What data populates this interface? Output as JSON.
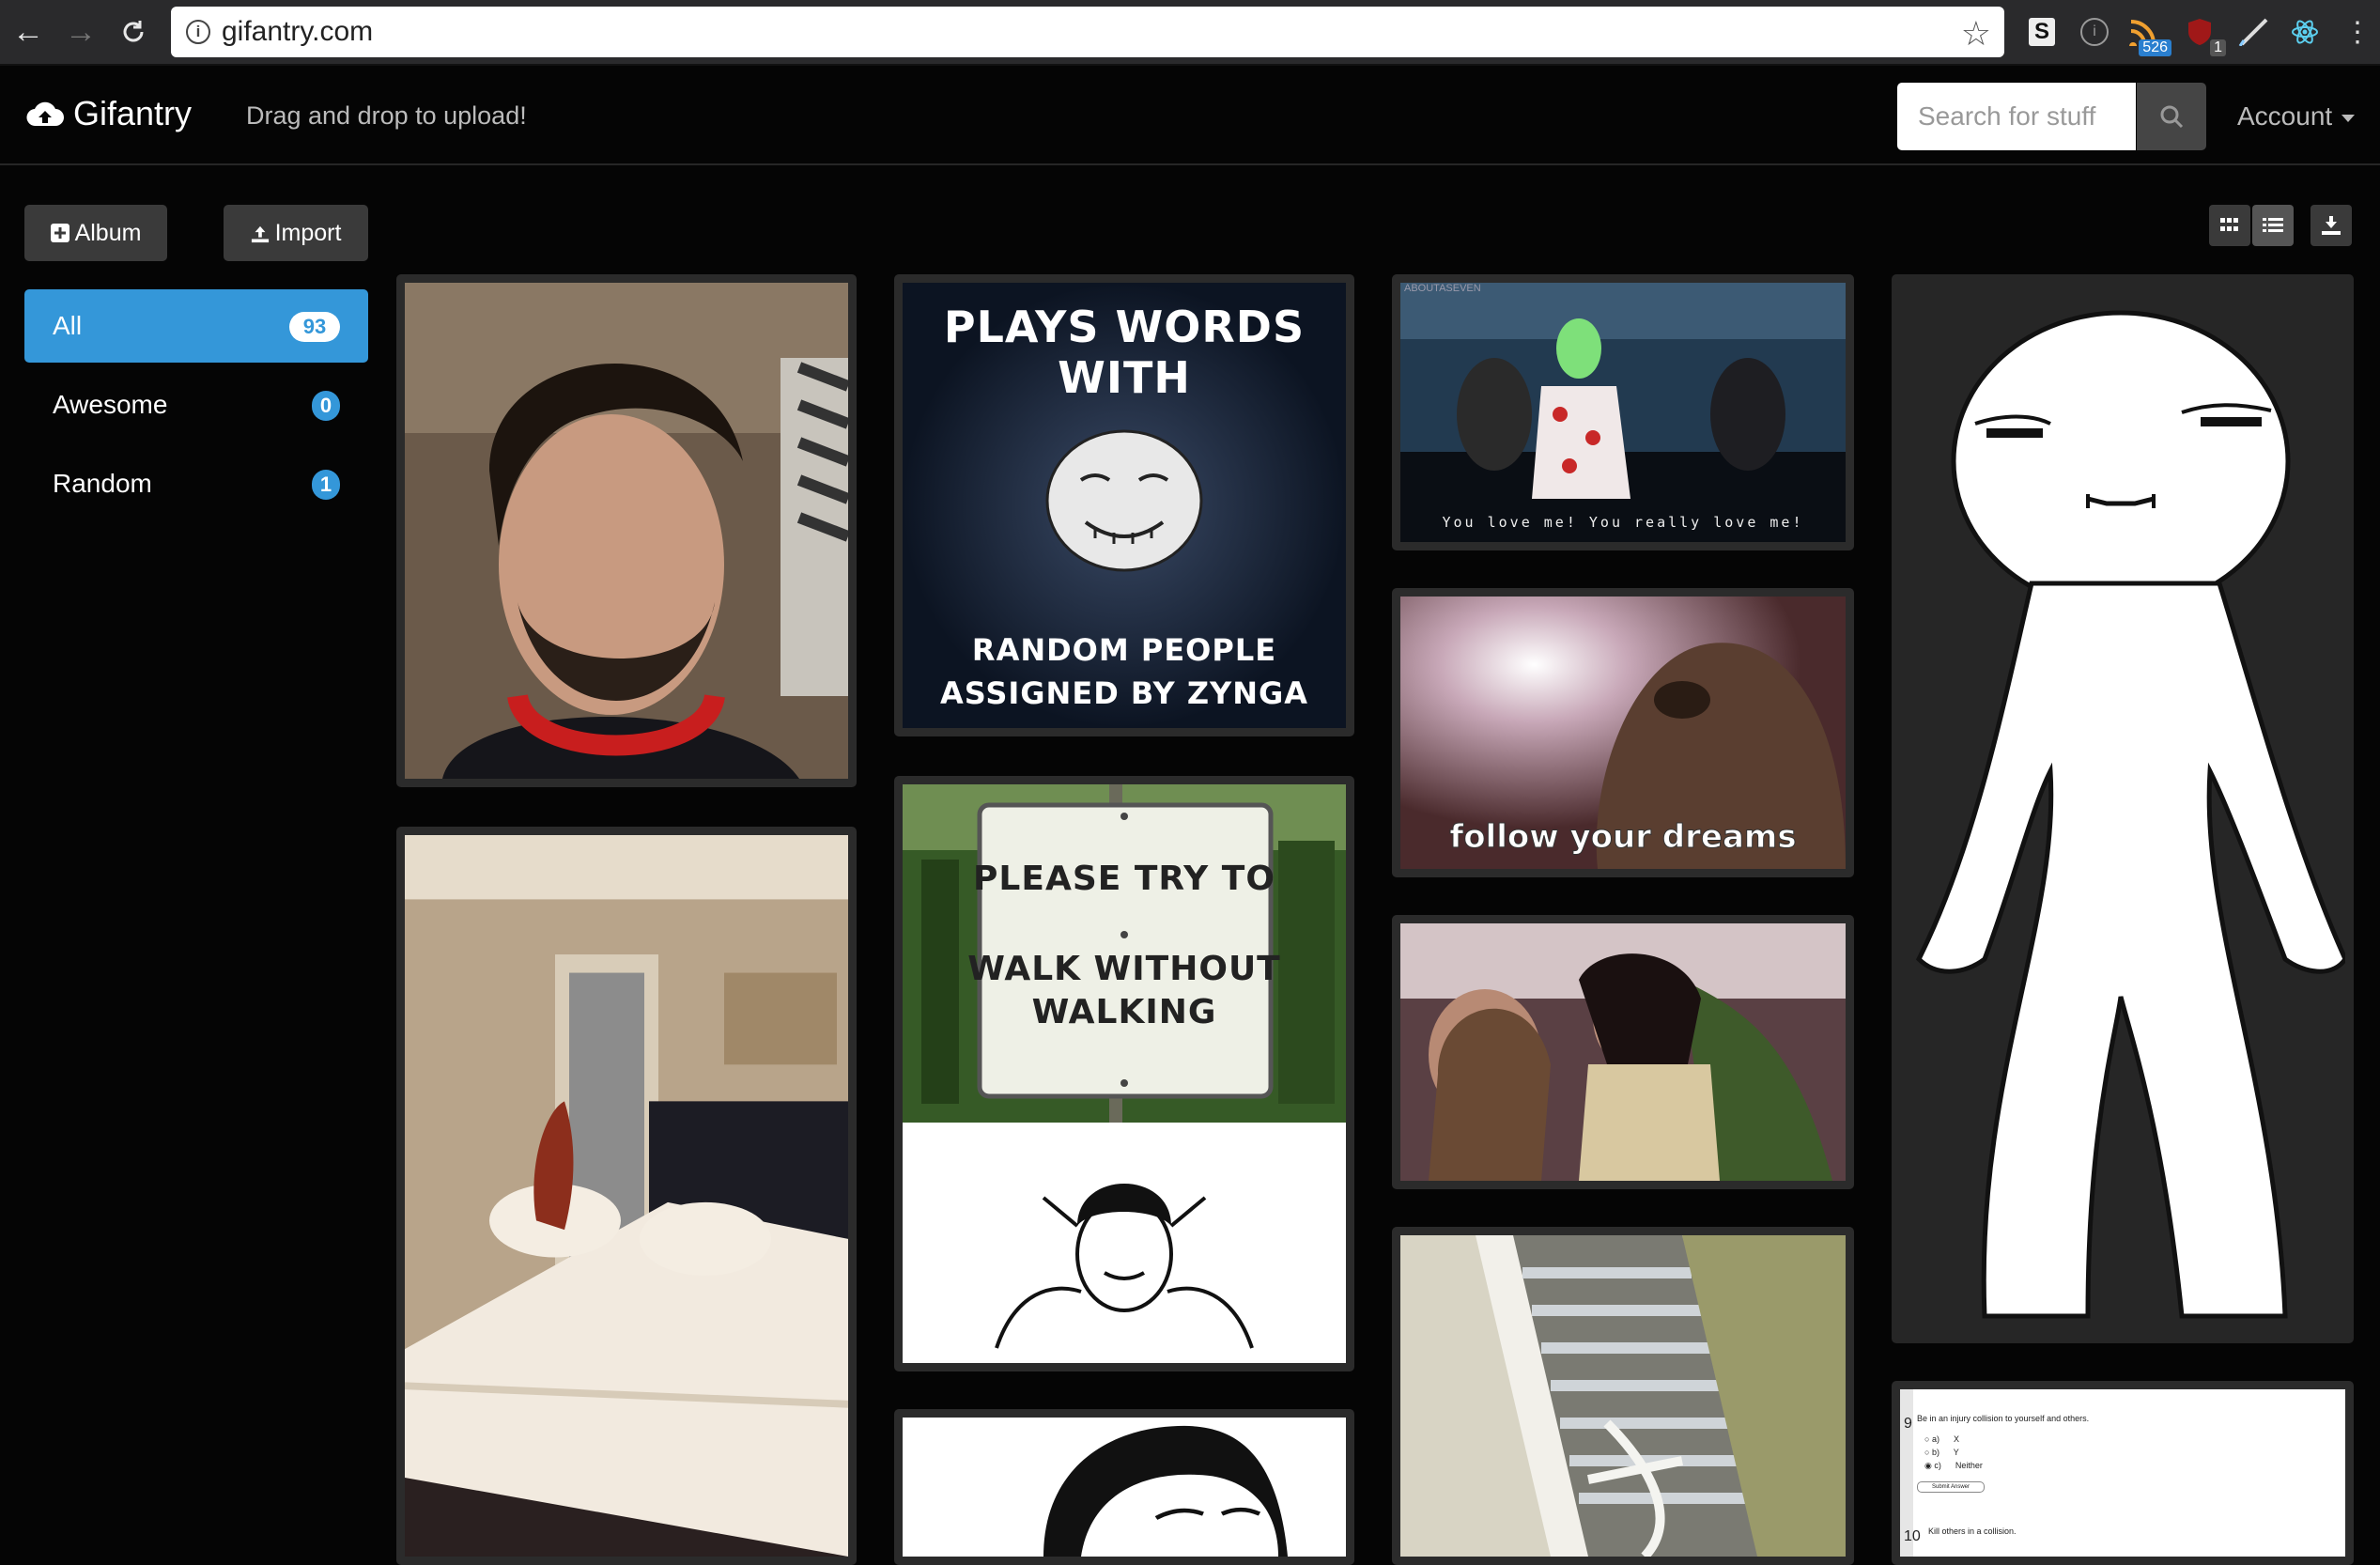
{
  "browser": {
    "url": "gifantry.com",
    "extensions": [
      {
        "icon": "s-extension-icon",
        "label": "S"
      },
      {
        "icon": "info-extension-icon",
        "label": "i"
      },
      {
        "icon": "rss-extension-icon",
        "badge": "526"
      },
      {
        "icon": "shield-extension-icon",
        "badge": "1"
      },
      {
        "icon": "pen-extension-icon"
      },
      {
        "icon": "react-extension-icon"
      }
    ]
  },
  "navbar": {
    "brand": "Gifantry",
    "tagline": "Drag and drop to upload!",
    "search_placeholder": "Search for stuff",
    "account": "Account"
  },
  "sidebar": {
    "album_button": "Album",
    "import_button": "Import",
    "categories": [
      {
        "label": "All",
        "count": "93",
        "active": true
      },
      {
        "label": "Awesome",
        "count": "0",
        "active": false
      },
      {
        "label": "Random",
        "count": "1",
        "active": false
      }
    ]
  },
  "gallery": {
    "items": [
      {
        "kind": "photo",
        "subject": "smiling bearded man with headphones"
      },
      {
        "kind": "meme",
        "top_text": "PLAYS WORDS WITH",
        "bottom_text": "RANDOM PEOPLE ASSIGNED BY ZYNGA"
      },
      {
        "kind": "gif",
        "subject": "masked man in white suit on stage",
        "corner": "ABOUTASEVEN",
        "caption": "You love me! You really love me!"
      },
      {
        "kind": "rage-comic",
        "subject": "white stick figure walking"
      },
      {
        "kind": "gif",
        "subject": "dog jumping on a bed"
      },
      {
        "kind": "sign",
        "sign_line1": "PLEASE TRY TO",
        "sign_line2": "WALK WITHOUT",
        "sign_line3": "WALKING"
      },
      {
        "kind": "gif",
        "subject": "sloth in bright light",
        "caption": "follow your dreams"
      },
      {
        "kind": "gif",
        "subject": "two women arguing"
      },
      {
        "kind": "gif",
        "subject": "cat falling on ladder"
      },
      {
        "kind": "meme",
        "subject": "rage comic face"
      },
      {
        "kind": "screenshot",
        "q9_num": "9",
        "q9": "Be in an injury collision to yourself and others.",
        "options": [
          "a)",
          "b)",
          "c)"
        ],
        "values": [
          "X",
          "Y",
          "Neither"
        ],
        "submit": "Submit Answer",
        "q10_num": "10",
        "q10": "Kill others in a collision."
      }
    ]
  },
  "colors": {
    "accent": "#3497d9",
    "background": "#050505",
    "card": "#2b2b2b"
  }
}
